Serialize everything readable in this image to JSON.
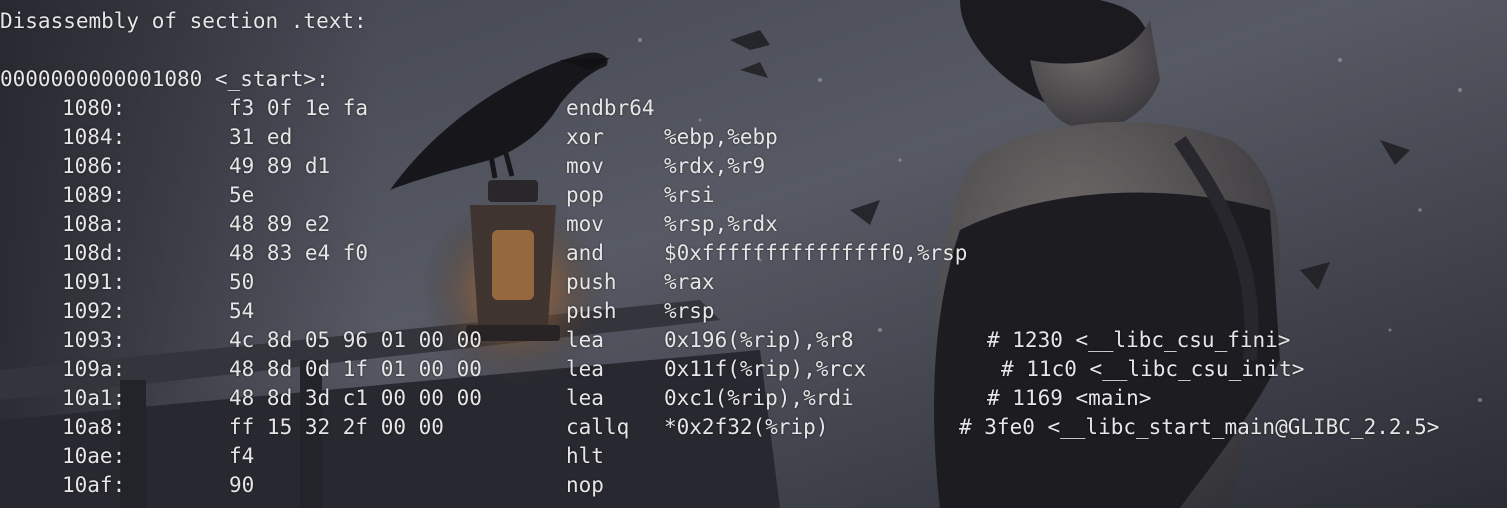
{
  "terminal": {
    "section_header": "Disassembly of section .text:",
    "symbol_header": "0000000000001080 <_start>:",
    "instructions": [
      {
        "addr": "1080:",
        "bytes": "f3 0f 1e fa",
        "mnemonic": "endbr64",
        "operands": "",
        "comment": ""
      },
      {
        "addr": "1084:",
        "bytes": "31 ed",
        "mnemonic": "xor",
        "operands": "%ebp,%ebp",
        "comment": ""
      },
      {
        "addr": "1086:",
        "bytes": "49 89 d1",
        "mnemonic": "mov",
        "operands": "%rdx,%r9",
        "comment": ""
      },
      {
        "addr": "1089:",
        "bytes": "5e",
        "mnemonic": "pop",
        "operands": "%rsi",
        "comment": ""
      },
      {
        "addr": "108a:",
        "bytes": "48 89 e2",
        "mnemonic": "mov",
        "operands": "%rsp,%rdx",
        "comment": ""
      },
      {
        "addr": "108d:",
        "bytes": "48 83 e4 f0",
        "mnemonic": "and",
        "operands": "$0xfffffffffffffff0,%rsp",
        "comment": ""
      },
      {
        "addr": "1091:",
        "bytes": "50",
        "mnemonic": "push",
        "operands": "%rax",
        "comment": ""
      },
      {
        "addr": "1092:",
        "bytes": "54",
        "mnemonic": "push",
        "operands": "%rsp",
        "comment": ""
      },
      {
        "addr": "1093:",
        "bytes": "4c 8d 05 96 01 00 00",
        "mnemonic": "lea",
        "operands": "0x196(%rip),%r8",
        "comment": "# 1230 <__libc_csu_fini>"
      },
      {
        "addr": "109a:",
        "bytes": "48 8d 0d 1f 01 00 00",
        "mnemonic": "lea",
        "operands": "0x11f(%rip),%rcx",
        "comment": "# 11c0 <__libc_csu_init>"
      },
      {
        "addr": "10a1:",
        "bytes": "48 8d 3d c1 00 00 00",
        "mnemonic": "lea",
        "operands": "0xc1(%rip),%rdi",
        "comment": "# 1169 <main>"
      },
      {
        "addr": "10a8:",
        "bytes": "ff 15 32 2f 00 00",
        "mnemonic": "callq",
        "operands": "*0x2f32(%rip)",
        "comment": "# 3fe0 <__libc_start_main@GLIBC_2.2.5>"
      },
      {
        "addr": "10ae:",
        "bytes": "f4",
        "mnemonic": "hlt",
        "operands": "",
        "comment": ""
      },
      {
        "addr": "10af:",
        "bytes": "90",
        "mnemonic": "nop",
        "operands": "",
        "comment": ""
      }
    ]
  },
  "background": {
    "colors": {
      "sky": "#5c606c",
      "shadow": "#2a2c33",
      "lantern_glow": "#e2a24a",
      "figure": "#1c1b1f",
      "bird": "#151517"
    },
    "icons": [
      "raven-image",
      "lantern-image",
      "figure-image"
    ]
  }
}
